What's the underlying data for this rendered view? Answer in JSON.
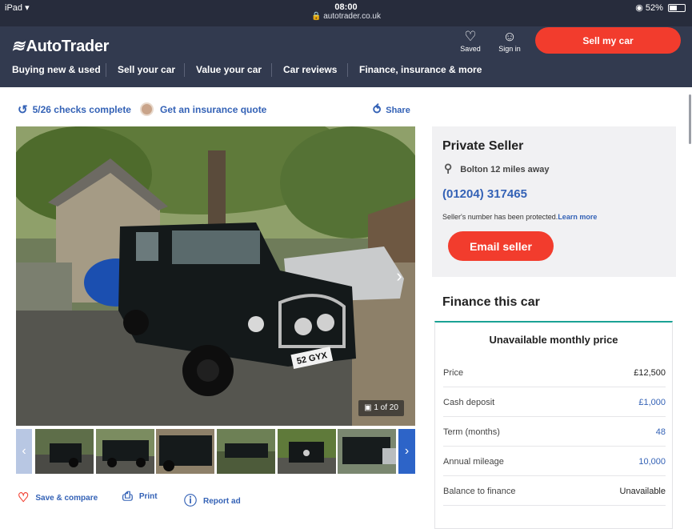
{
  "status_bar": {
    "device": "iPad",
    "time": "08:00",
    "url": "autotrader.co.uk",
    "battery": "52%",
    "battery_level": 0.52
  },
  "header": {
    "logo": "AutoTrader",
    "saved_label": "Saved",
    "signin_label": "Sign in",
    "sell_button": "Sell my car",
    "nav": [
      "Buying new & used",
      "Sell your car",
      "Value your car",
      "Car reviews",
      "Finance, insurance & more"
    ]
  },
  "toolbar": {
    "checks": "5/26 checks complete",
    "insurance": "Get an insurance quote",
    "share": "Share"
  },
  "gallery": {
    "counter": "1 of 20",
    "plate": "52 GYX"
  },
  "actions": {
    "save": "Save & compare",
    "print": "Print",
    "report": "Report ad"
  },
  "seller": {
    "title": "Private Seller",
    "location": "Bolton 12 miles away",
    "phone": "(01204) 317465",
    "note": "Seller's number has been protected.",
    "learn_more": "Learn more",
    "email_button": "Email seller"
  },
  "finance": {
    "title": "Finance this car",
    "unavailable_heading": "Unavailable monthly price",
    "rows": [
      {
        "label": "Price",
        "value": "£12,500"
      },
      {
        "label": "Cash deposit",
        "value": "£1,000"
      },
      {
        "label": "Term (months)",
        "value": "48"
      },
      {
        "label": "Annual mileage",
        "value": "10,000"
      },
      {
        "label": "Balance to finance",
        "value": "Unavailable"
      }
    ]
  },
  "colors": {
    "accent_red": "#f23c2d",
    "header_bg": "#323a4f",
    "link_blue": "#3462b6",
    "finance_teal": "#1aa295"
  }
}
